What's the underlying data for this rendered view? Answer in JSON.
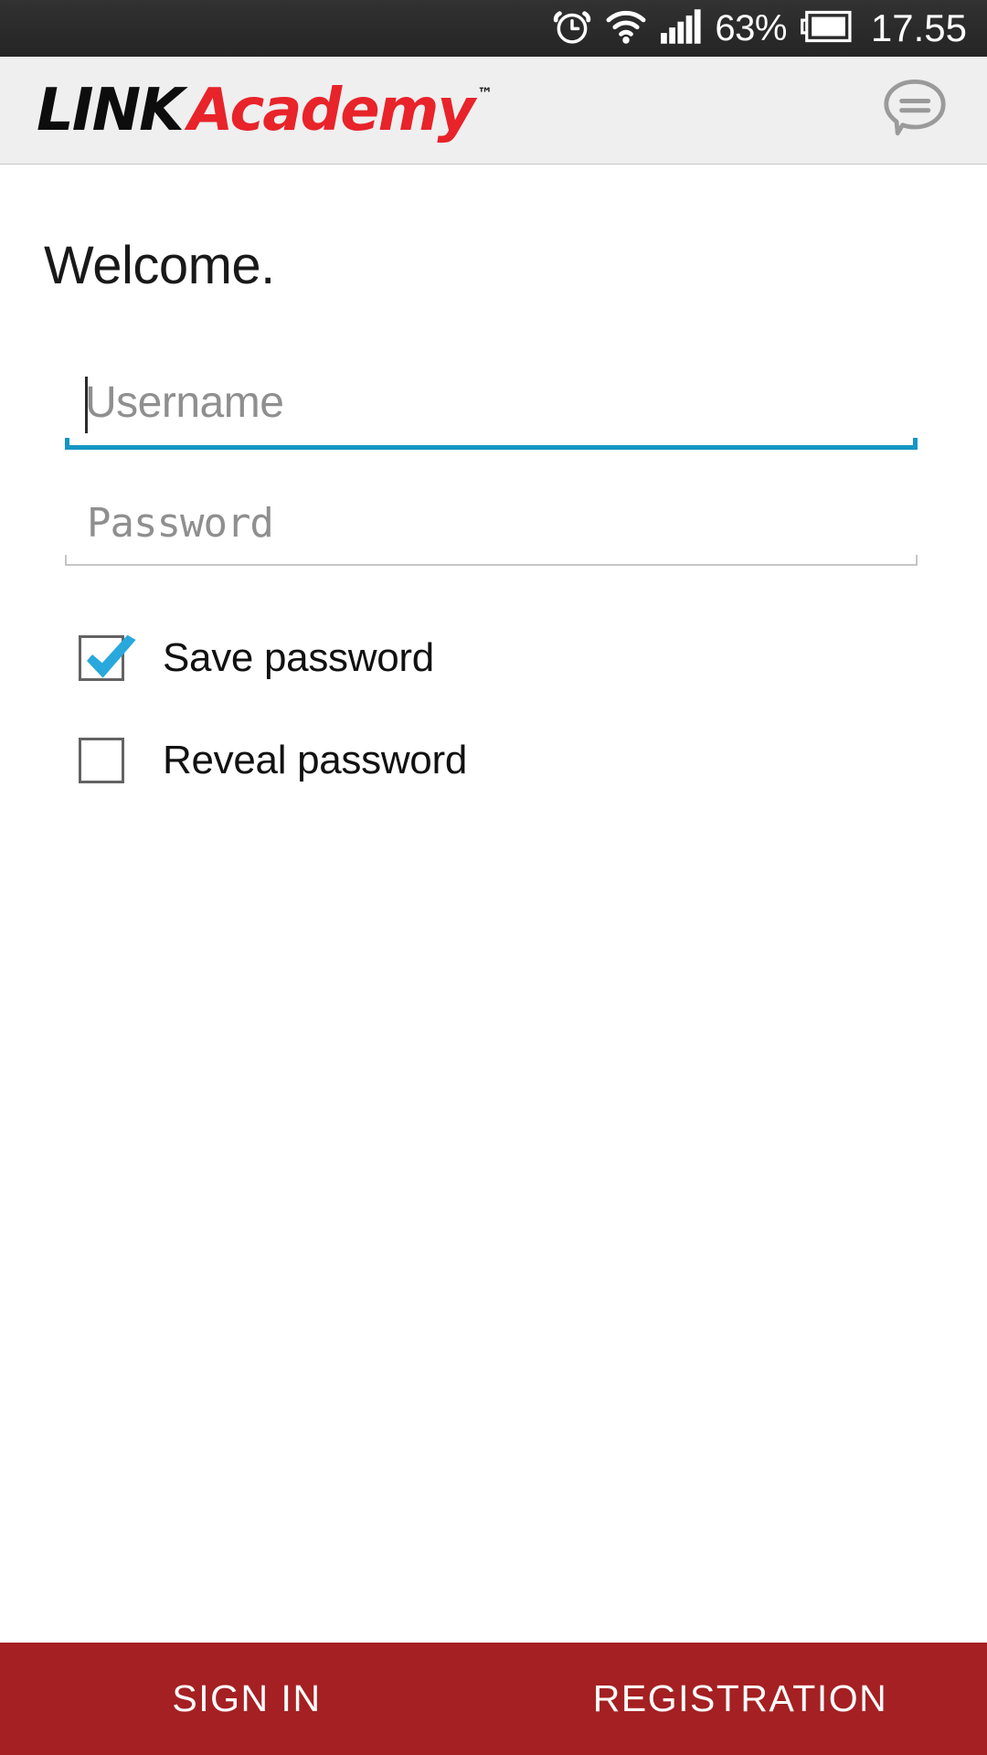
{
  "status_bar": {
    "alarm_icon": "alarm-clock-icon",
    "wifi_icon": "wifi-icon",
    "signal_icon": "cellular-signal-icon",
    "battery_percent": "63%",
    "battery_icon": "battery-icon",
    "clock": "17.55",
    "background_color": "#2b2b2b"
  },
  "header": {
    "logo_link": "LINK",
    "logo_academy": "Academy",
    "logo_tm": "™",
    "chat_icon": "chat-bubble-icon",
    "background_color": "#efefef",
    "brand_red": "#e8232a"
  },
  "main": {
    "welcome_title": "Welcome.",
    "username_field": {
      "value": "",
      "placeholder": "Username",
      "focused": true,
      "underline_color": "#1496c4"
    },
    "password_field": {
      "value": "",
      "placeholder": "Password",
      "focused": false,
      "underline_color": "#c6c6c6"
    },
    "save_password": {
      "label": "Save password",
      "checked": true,
      "check_color": "#29a8dd"
    },
    "reveal_password": {
      "label": "Reveal password",
      "checked": false
    }
  },
  "bottom_bar": {
    "sign_in_label": "SIGN IN",
    "registration_label": "REGISTRATION",
    "background_color": "#a52022"
  }
}
